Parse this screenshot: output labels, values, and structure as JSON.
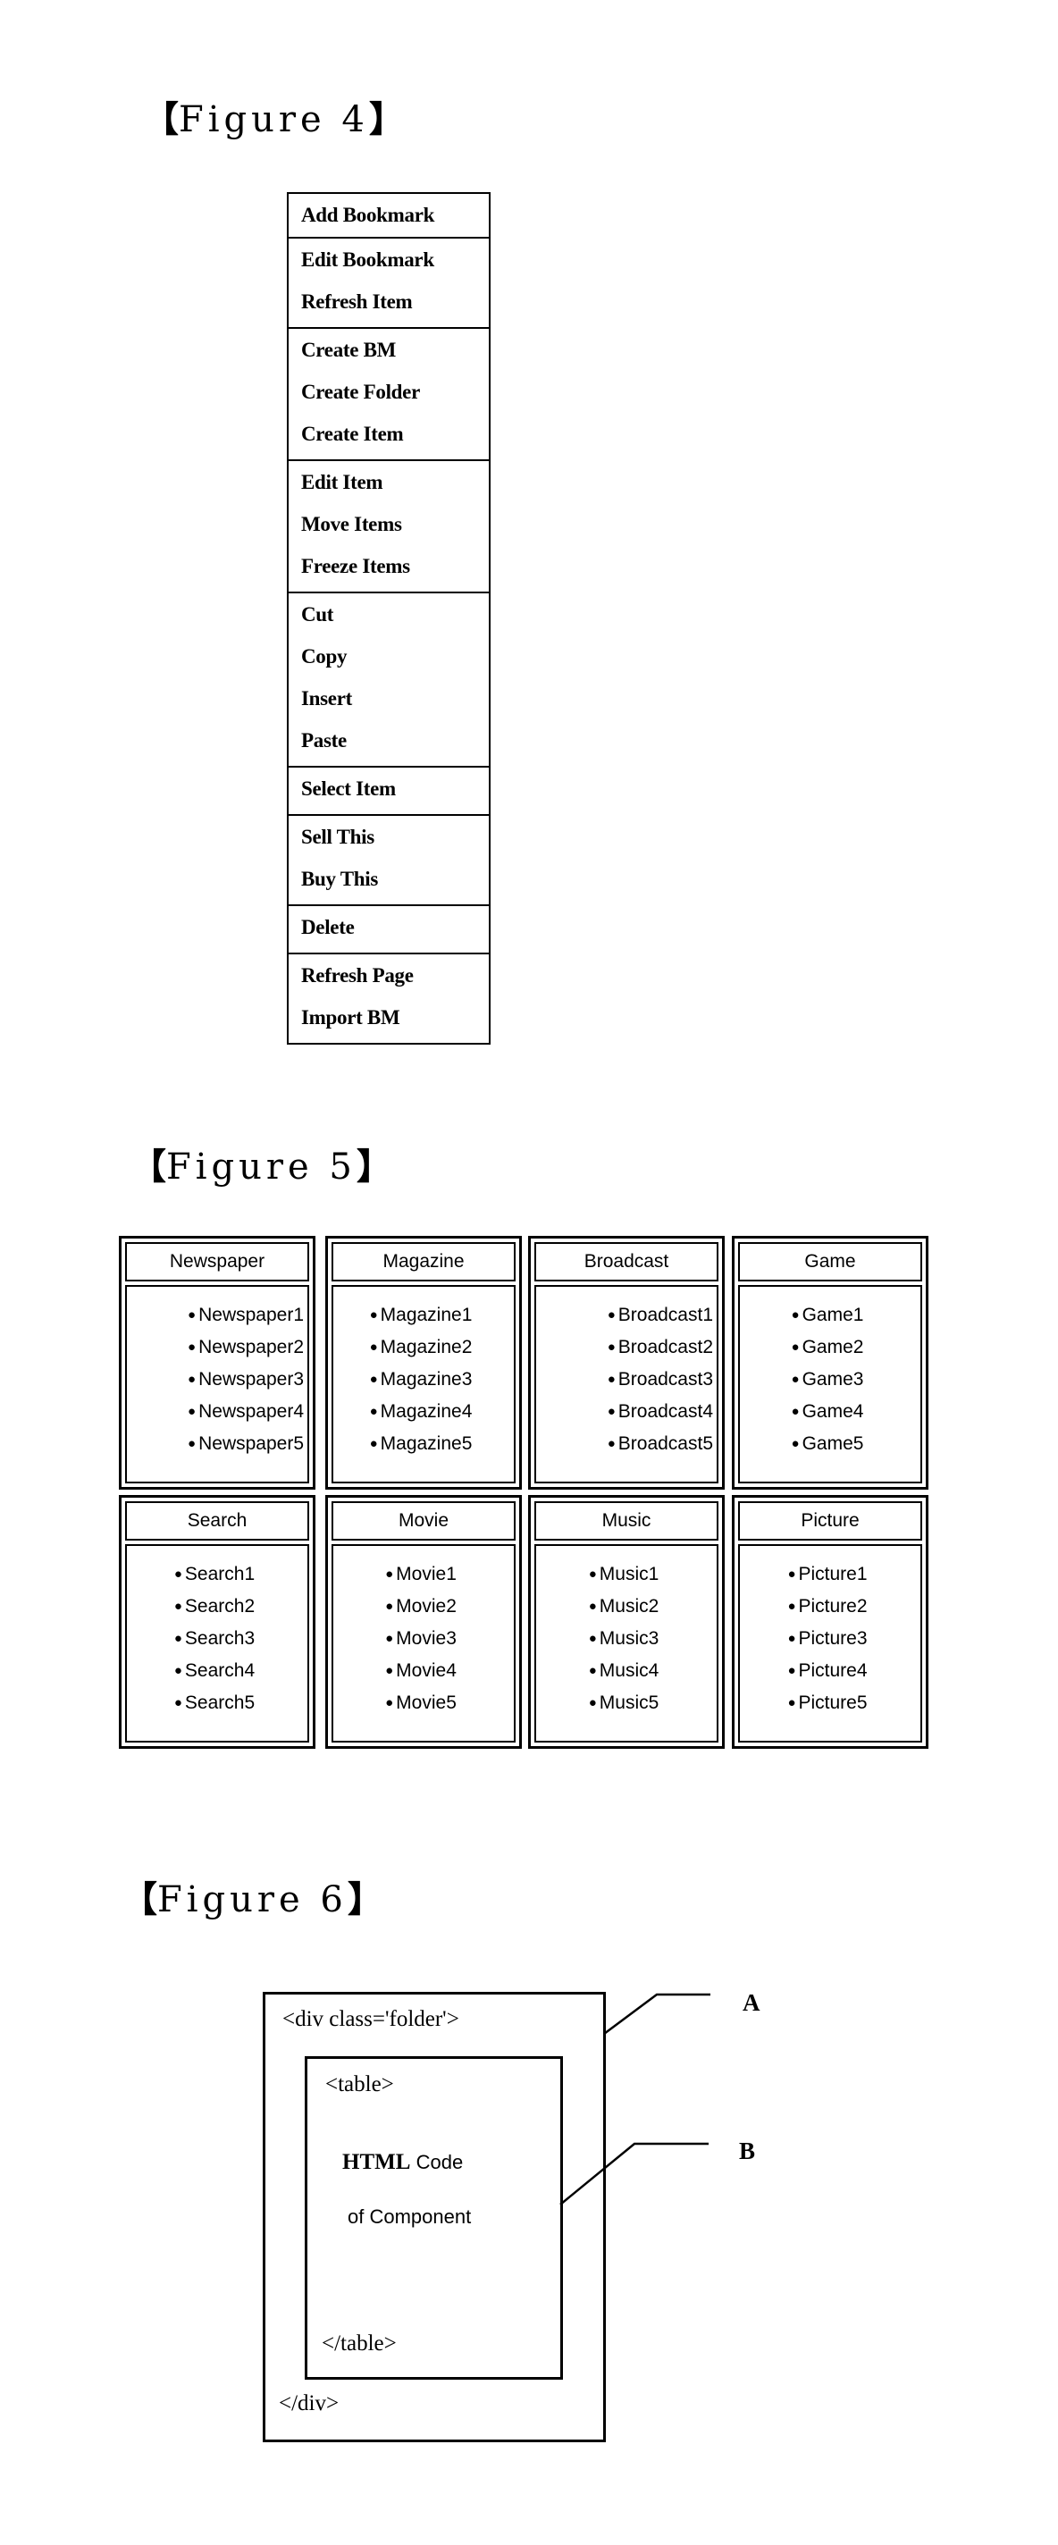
{
  "figures": {
    "fig4": {
      "label_open": "【",
      "label_text": "Figure 4",
      "label_close": "】",
      "menu_groups": [
        [
          "Add Bookmark"
        ],
        [
          "Edit Bookmark",
          "Refresh Item"
        ],
        [
          "Create BM",
          "Create Folder",
          "Create Item"
        ],
        [
          "Edit Item",
          "Move Items",
          "Freeze Items"
        ],
        [
          "Cut",
          "Copy",
          "Insert",
          "Paste"
        ],
        [
          "Select Item"
        ],
        [
          "Sell This",
          "Buy This"
        ],
        [
          "Delete"
        ],
        [
          "Refresh Page",
          "Import BM"
        ]
      ]
    },
    "fig5": {
      "label_open": "【",
      "label_text": "Figure 5",
      "label_close": "】",
      "bullet": "●",
      "panels": [
        {
          "title": "Newspaper",
          "items": [
            "Newspaper1",
            "Newspaper2",
            "Newspaper3",
            "Newspaper4",
            "Newspaper5"
          ]
        },
        {
          "title": "Magazine",
          "items": [
            "Magazine1",
            "Magazine2",
            "Magazine3",
            "Magazine4",
            "Magazine5"
          ]
        },
        {
          "title": "Broadcast",
          "items": [
            "Broadcast1",
            "Broadcast2",
            "Broadcast3",
            "Broadcast4",
            "Broadcast5"
          ]
        },
        {
          "title": "Game",
          "items": [
            "Game1",
            "Game2",
            "Game3",
            "Game4",
            "Game5"
          ]
        },
        {
          "title": "Search",
          "items": [
            "Search1",
            "Search2",
            "Search3",
            "Search4",
            "Search5"
          ]
        },
        {
          "title": "Movie",
          "items": [
            "Movie1",
            "Movie2",
            "Movie3",
            "Movie4",
            "Movie5"
          ]
        },
        {
          "title": "Music",
          "items": [
            "Music1",
            "Music2",
            "Music3",
            "Music4",
            "Music5"
          ]
        },
        {
          "title": "Picture",
          "items": [
            "Picture1",
            "Picture2",
            "Picture3",
            "Picture4",
            "Picture5"
          ]
        }
      ]
    },
    "fig6": {
      "label_open": "【",
      "label_text": "Figure 6",
      "label_close": "】",
      "div_open": "<div class='folder'>",
      "table_open": "<table>",
      "html_word": "HTML",
      "code_word": "Code",
      "component_line": "of Component",
      "table_close": "</table>",
      "div_close": "</div>",
      "callout_a": "A",
      "callout_b": "B"
    }
  }
}
